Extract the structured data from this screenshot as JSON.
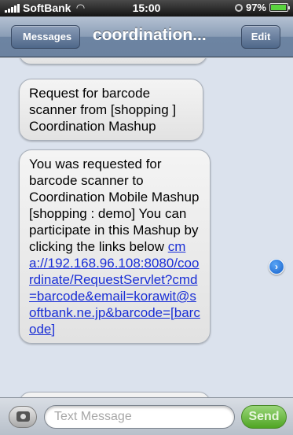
{
  "status_bar": {
    "carrier": "SoftBank",
    "time": "15:00",
    "battery": "97%",
    "battery_level": 0.97,
    "icons": [
      "signal-icon",
      "wifi-icon",
      "rotation-lock-icon",
      "battery-icon"
    ]
  },
  "nav": {
    "back_label": "Messages",
    "title": "coordination...",
    "edit_label": "Edit"
  },
  "messages": [
    {
      "text": "Request for barcode scanner from  [shopping ] Coordination Mashup"
    },
    {
      "text": "You was requested for barcode scanner to Coordination Mobile Mashup [shopping : demo] You can participate in this Mashup by clicking the links below ",
      "link": "cma://192.168.96.108:8080/coordinate/RequestServlet?cmd=barcode&email=korawit@softbank.ne.jp&barcode=[barcode]"
    }
  ],
  "input": {
    "placeholder": "Text Message",
    "value": "",
    "send_label": "Send"
  },
  "colors": {
    "nav_gradient": "#7d91ad",
    "link": "#1a2fd6",
    "send_green": "#4fa523",
    "background": "#dbe2ed"
  }
}
